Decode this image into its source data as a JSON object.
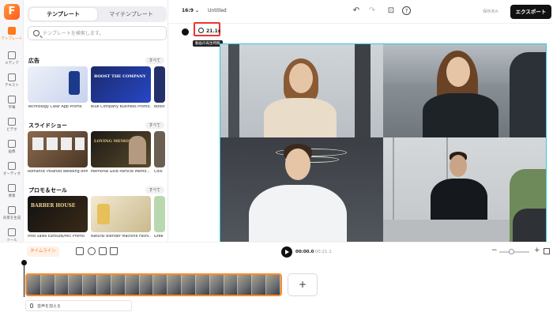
{
  "app": {
    "logo_letter": "F",
    "accent": "#ff7a1a",
    "selection": "#34c7e6",
    "highlight": "#e33333"
  },
  "rail": [
    {
      "label": "テンプレート",
      "icon": "template-icon",
      "active": true
    },
    {
      "label": "メディア",
      "icon": "media-icon"
    },
    {
      "label": "テキスト",
      "icon": "text-icon"
    },
    {
      "label": "字幕",
      "icon": "subtitle-icon"
    },
    {
      "label": "ビデオ",
      "icon": "video-icon"
    },
    {
      "label": "画像",
      "icon": "image-icon"
    },
    {
      "label": "オーディオ",
      "icon": "audio-icon"
    },
    {
      "label": "要素",
      "icon": "element-icon"
    },
    {
      "label": "背景を生成",
      "icon": "generate-icon"
    },
    {
      "label": "ツール",
      "icon": "tool-icon"
    }
  ],
  "panel": {
    "tabs": [
      "テンプレート",
      "マイテンプレート"
    ],
    "search_placeholder": "テンプレートを検索します。",
    "see_all": "すべて",
    "sections": [
      {
        "title": "広告",
        "items": [
          "Technology Clear App Promo",
          "Blue Company Business Promo...",
          "Boost"
        ]
      },
      {
        "title": "スライドショー",
        "items": [
          "Romantic Polaroid Wedding Annive",
          "Memorial Gold Particle Memo...",
          "Colo"
        ]
      },
      {
        "title": "プロモ＆セール",
        "items": [
          "iPod Sales Earbuds/Mic Promo",
          "Natural Blender Machine Fashi...",
          "Gree"
        ]
      }
    ]
  },
  "thumb_texts": [
    "",
    "BOOST THE COMPANY",
    "",
    "",
    "LOVING MEMORY",
    "",
    "BARBER HOUSE",
    "",
    ""
  ],
  "topbar": {
    "ratio": "16:9 ⌄",
    "title": "Untitled",
    "saved": "保存済み",
    "export": "エクスポート"
  },
  "canvas": {
    "duration": "21.1s",
    "tooltip": "動画の再生時間"
  },
  "controls": {
    "timeline_label": "タイムライン",
    "current_time": "00:00.0",
    "total_time": "/ 00:21.1"
  },
  "timeline": {
    "add_audio": "音声を加える",
    "add_clip": "+"
  }
}
